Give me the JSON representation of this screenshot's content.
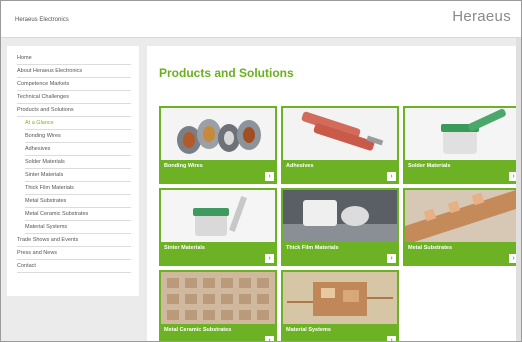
{
  "header": {
    "site_title": "Heraeus Electronics",
    "brand": "Heraeus"
  },
  "sidebar": {
    "items": [
      {
        "label": "Home",
        "sub": false,
        "active": false
      },
      {
        "label": "About Heraeus Electronics",
        "sub": false,
        "active": false
      },
      {
        "label": "Competence Markets",
        "sub": false,
        "active": false
      },
      {
        "label": "Technical Challenges",
        "sub": false,
        "active": false
      },
      {
        "label": "Products and Solutions",
        "sub": false,
        "active": false
      },
      {
        "label": "At a Glance",
        "sub": true,
        "active": true
      },
      {
        "label": "Bonding Wires",
        "sub": true,
        "active": false
      },
      {
        "label": "Adhesives",
        "sub": true,
        "active": false
      },
      {
        "label": "Solder Materials",
        "sub": true,
        "active": false
      },
      {
        "label": "Sinter Materials",
        "sub": true,
        "active": false
      },
      {
        "label": "Thick Film Materials",
        "sub": true,
        "active": false
      },
      {
        "label": "Metal Substrates",
        "sub": true,
        "active": false
      },
      {
        "label": "Metal Ceramic Substrates",
        "sub": true,
        "active": false
      },
      {
        "label": "Material Systems",
        "sub": true,
        "active": false
      },
      {
        "label": "Trade Shows and Events",
        "sub": false,
        "active": false
      },
      {
        "label": "Press and News",
        "sub": false,
        "active": false
      },
      {
        "label": "Contact",
        "sub": false,
        "active": false
      }
    ]
  },
  "main": {
    "title": "Products and Solutions",
    "tiles": [
      {
        "label": "Bonding Wires",
        "image": "bonding-wire-spools",
        "arrow": "›"
      },
      {
        "label": "Adhesives",
        "image": "adhesive-syringes",
        "arrow": "›"
      },
      {
        "label": "Solder Materials",
        "image": "solder-paste-jar",
        "arrow": "›"
      },
      {
        "label": "Sinter Materials",
        "image": "sinter-paste-jar",
        "arrow": "›"
      },
      {
        "label": "Thick Film Materials",
        "image": "thick-film-printing",
        "arrow": "›"
      },
      {
        "label": "Metal Substrates",
        "image": "metal-substrate-strip",
        "arrow": "›"
      },
      {
        "label": "Metal Ceramic Substrates",
        "image": "ceramic-substrate-panel",
        "arrow": "›"
      },
      {
        "label": "Material Systems",
        "image": "material-system-module",
        "arrow": "›"
      }
    ]
  },
  "colors": {
    "accent": "#6db224",
    "title": "#6ab01e",
    "active_nav": "#7cb51f"
  }
}
